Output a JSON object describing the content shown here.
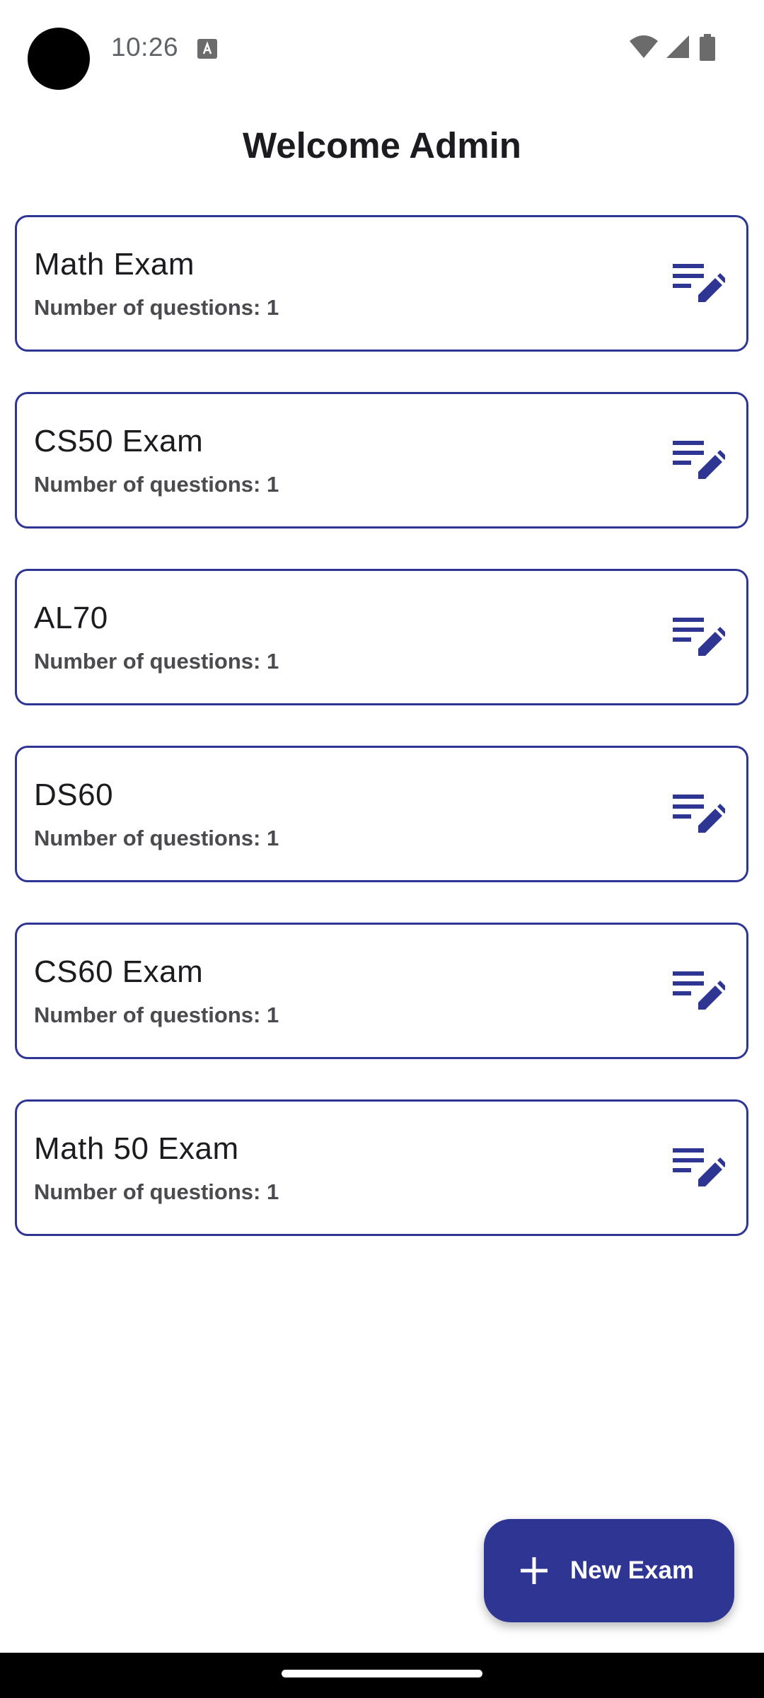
{
  "status_bar": {
    "time": "10:26"
  },
  "header": {
    "title": "Welcome Admin"
  },
  "exams": [
    {
      "name": "Math Exam",
      "questions": "Number of questions: 1"
    },
    {
      "name": "CS50 Exam",
      "questions": "Number of questions: 1"
    },
    {
      "name": "AL70",
      "questions": "Number of questions: 1"
    },
    {
      "name": "DS60",
      "questions": "Number of questions: 1"
    },
    {
      "name": "CS60 Exam",
      "questions": "Number of questions: 1"
    },
    {
      "name": "Math 50 Exam",
      "questions": "Number of questions: 1"
    }
  ],
  "fab": {
    "label": "New Exam",
    "icon": "plus-icon"
  },
  "colors": {
    "accent": "#2f3592",
    "card_border": "#2f3592",
    "icon": "#2f3592",
    "fab_background": "#2f3592",
    "title_text": "#1c1b1f",
    "secondary_text": "#4a4a4f"
  },
  "icons": {
    "card_action": "edit-list-icon"
  }
}
